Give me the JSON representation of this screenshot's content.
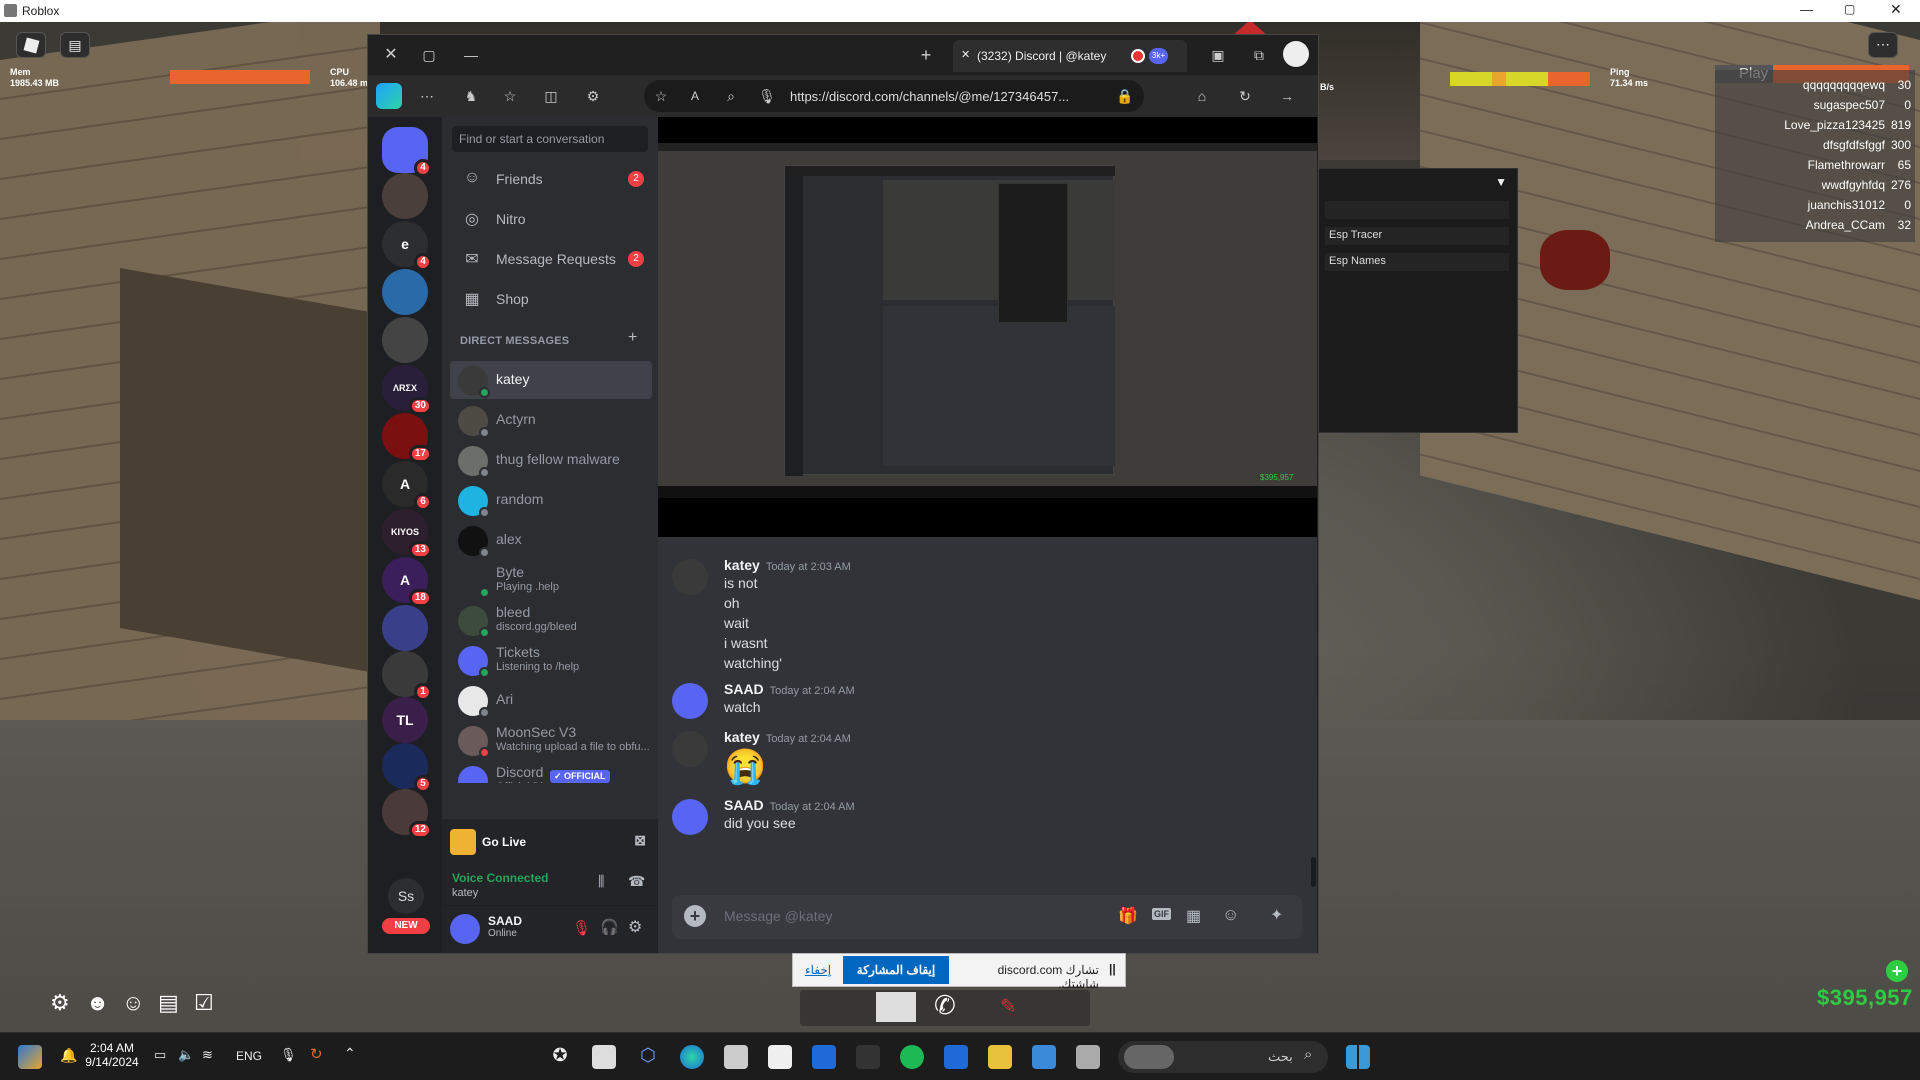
{
  "window_title": "Roblox",
  "hud": {
    "mem_label": "Mem",
    "mem_value": "1985.43 MB",
    "cpu_label": "CPU",
    "cpu_value": "106.48 m",
    "ping_label": "Ping",
    "ping_value": "71.34 ms",
    "net_value": "B/s",
    "play_label": "Play"
  },
  "leaderboard": [
    {
      "name": "qqqqqqqqqewq",
      "value": "30"
    },
    {
      "name": "sugaspec507",
      "value": "0"
    },
    {
      "name": "Love_pizza123425",
      "value": "819"
    },
    {
      "name": "dfsgfdfsfggf",
      "value": "300"
    },
    {
      "name": "Flamethrowarr",
      "value": "65"
    },
    {
      "name": "wwdfgyhfdq",
      "value": "276"
    },
    {
      "name": "juanchis31012",
      "value": "0"
    },
    {
      "name": "Andrea_CCam",
      "value": "32"
    }
  ],
  "cheat_menu": {
    "items": [
      "Esp Tracer",
      "Esp Names"
    ],
    "chevron": "▼"
  },
  "browser": {
    "tab_title": "(3232) Discord | @katey",
    "url": "https://discord.com/channels/@me/127346457...",
    "tab_badge": "3k+"
  },
  "discord": {
    "search_placeholder": "Find or start a conversation",
    "nav": [
      {
        "label": "Friends",
        "badge": "2",
        "icon": "friends-icon"
      },
      {
        "label": "Nitro",
        "badge": "",
        "icon": "nitro-icon"
      },
      {
        "label": "Message Requests",
        "badge": "2",
        "icon": "envelope-icon"
      },
      {
        "label": "Shop",
        "badge": "",
        "icon": "shop-icon"
      }
    ],
    "dm_header": "DIRECT MESSAGES",
    "dm_add": "+",
    "dms": [
      {
        "name": "katey",
        "sub": "",
        "selected": true,
        "color": "#3a3a3a",
        "status": "#23a55a"
      },
      {
        "name": "Actyrn",
        "sub": "",
        "selected": false,
        "color": "#4e4a44",
        "status": "#80848e"
      },
      {
        "name": "thug fellow malware",
        "sub": "",
        "selected": false,
        "color": "#6a6f6a",
        "status": "#80848e"
      },
      {
        "name": "random",
        "sub": "",
        "selected": false,
        "color": "#1eb3e0",
        "status": "#80848e"
      },
      {
        "name": "alex",
        "sub": "",
        "selected": false,
        "color": "#111111",
        "status": "#80848e"
      },
      {
        "name": "Byte",
        "sub": "Playing .help",
        "selected": false,
        "color": "#2b2d31",
        "status": "#23a55a"
      },
      {
        "name": "bleed",
        "sub": "discord.gg/bleed",
        "selected": false,
        "color": "#3d4b3d",
        "status": "#23a55a"
      },
      {
        "name": "Tickets",
        "sub": "Listening to /help",
        "selected": false,
        "color": "#5865f2",
        "status": "#23a55a"
      },
      {
        "name": "Ari",
        "sub": "",
        "selected": false,
        "color": "#e8e8e8",
        "status": "#80848e"
      },
      {
        "name": "MoonSec V3",
        "sub": "Watching upload a file to obfu...",
        "selected": false,
        "color": "#6a5a5a",
        "status": "#f23f43"
      },
      {
        "name": "Discord",
        "sub": "Official Discord Message",
        "selected": false,
        "color": "#5865f2",
        "status": ""
      }
    ],
    "official_badge": "✓ OFFICIAL",
    "guilds": [
      {
        "label": "",
        "badge": "4",
        "color": "#5865f2"
      },
      {
        "label": "",
        "badge": "",
        "color": "#4a3f3a"
      },
      {
        "label": "e",
        "badge": "4",
        "color": "#2b2d31"
      },
      {
        "label": "",
        "badge": "",
        "color": "#2a6aa8"
      },
      {
        "label": "",
        "badge": "",
        "color": "#444"
      },
      {
        "label": "ΛRΣX",
        "badge": "30",
        "color": "#2a1f3a"
      },
      {
        "label": "",
        "badge": "17",
        "color": "#7a1010"
      },
      {
        "label": "A",
        "badge": "6",
        "color": "#2a2a2a"
      },
      {
        "label": "KIYOS",
        "badge": "13",
        "color": "#2d1f2d"
      },
      {
        "label": "A",
        "badge": "18",
        "color": "#3a1f5a"
      },
      {
        "label": "",
        "badge": "",
        "color": "#3a3f8a"
      },
      {
        "label": "",
        "badge": "1",
        "color": "#3a3a3a"
      },
      {
        "label": "TL",
        "badge": "",
        "color": "#3a1f4a"
      },
      {
        "label": "",
        "badge": "5",
        "color": "#1a2a5a"
      },
      {
        "label": "",
        "badge": "12",
        "color": "#4a3a3a"
      }
    ],
    "profile_initials": "Ss",
    "new_label": "NEW",
    "go_live": "Go Live",
    "voice_connected": "Voice Connected",
    "voice_channel": "katey",
    "user_name": "SAAD",
    "user_status": "Online",
    "messages": [
      {
        "author": "katey",
        "time": "Today at 2:03 AM",
        "lines": [
          "is not",
          "oh",
          "wait",
          "i wasnt",
          "watching'"
        ]
      },
      {
        "author": "SAAD",
        "time": "Today at 2:04 AM",
        "lines": [
          "watch"
        ]
      },
      {
        "author": "katey",
        "time": "Today at 2:04 AM",
        "lines": [
          "😭"
        ]
      },
      {
        "author": "SAAD",
        "time": "Today at 2:04 AM",
        "lines": [
          "did you see"
        ]
      }
    ],
    "composer_placeholder": "Message @katey"
  },
  "share_bar": {
    "text": "تشارك discord.com شاشتك.",
    "stop_label": "إيقاف المشاركة",
    "hide_label": "إخفاء",
    "pause": "||"
  },
  "money": "$395,957",
  "taskbar": {
    "time": "2:04 AM",
    "date": "9/14/2024",
    "lang": "ENG",
    "search_label": "بحث"
  }
}
